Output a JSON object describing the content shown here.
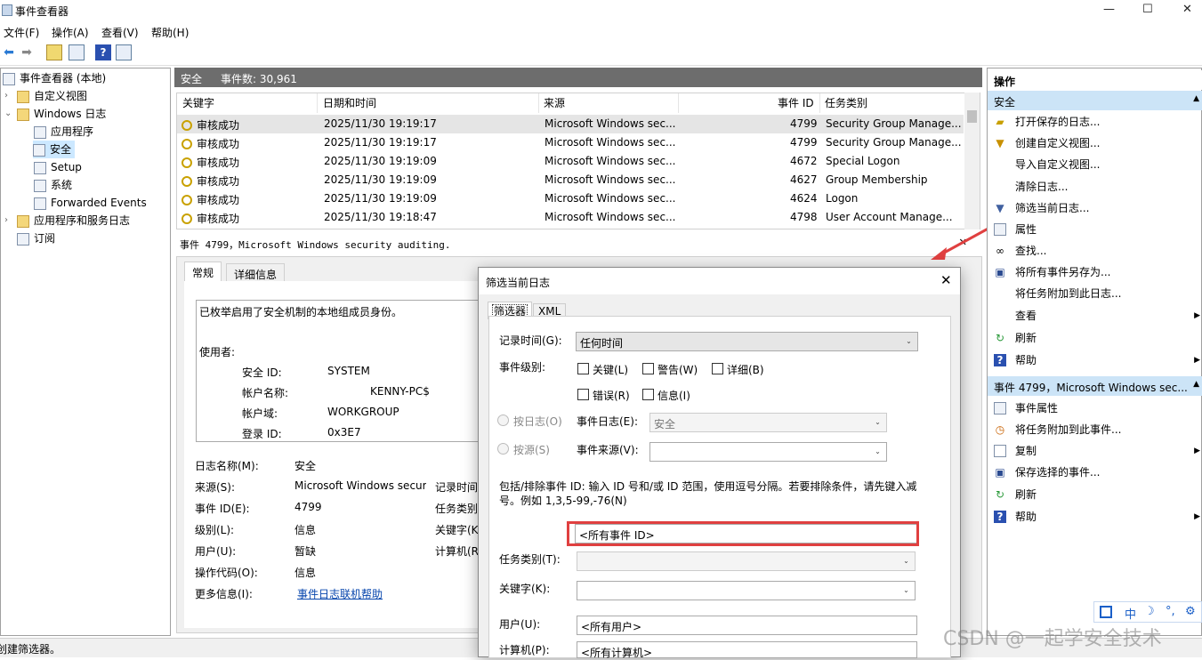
{
  "window": {
    "title": "事件查看器",
    "minimize": "—",
    "maximize": "☐",
    "close": "✕"
  },
  "menu": [
    "文件(F)",
    "操作(A)",
    "查看(V)",
    "帮助(H)"
  ],
  "tree": {
    "root": "事件查看器 (本地)",
    "custom_views": "自定义视图",
    "windows_logs": "Windows 日志",
    "app": "应用程序",
    "security": "安全",
    "setup": "Setup",
    "system": "系统",
    "forwarded": "Forwarded Events",
    "app_services": "应用程序和服务日志",
    "subscriptions": "订阅"
  },
  "center": {
    "log_name": "安全",
    "event_count": "事件数: 30,961"
  },
  "grid": {
    "columns": [
      "关键字",
      "日期和时间",
      "来源",
      "事件 ID",
      "任务类别"
    ],
    "rows": [
      [
        "审核成功",
        "2025/11/30 19:19:17",
        "Microsoft Windows sec...",
        "4799",
        "Security Group Manage..."
      ],
      [
        "审核成功",
        "2025/11/30 19:19:17",
        "Microsoft Windows sec...",
        "4799",
        "Security Group Manage..."
      ],
      [
        "审核成功",
        "2025/11/30 19:19:09",
        "Microsoft Windows sec...",
        "4672",
        "Special Logon"
      ],
      [
        "审核成功",
        "2025/11/30 19:19:09",
        "Microsoft Windows sec...",
        "4627",
        "Group Membership"
      ],
      [
        "审核成功",
        "2025/11/30 19:19:09",
        "Microsoft Windows sec...",
        "4624",
        "Logon"
      ],
      [
        "审核成功",
        "2025/11/30 19:18:47",
        "Microsoft Windows sec...",
        "4798",
        "User Account Manage..."
      ]
    ]
  },
  "detail": {
    "header": "事件 4799，Microsoft Windows security auditing.",
    "tab_general": "常规",
    "tab_details": "详细信息",
    "description": "已枚举启用了安全机制的本地组成员身份。",
    "subject": "使用者:",
    "sid_label": "安全 ID:",
    "sid_value": "SYSTEM",
    "account_label": "帐户名称:",
    "account_value": "KENNY-PC$",
    "domain_label": "帐户域:",
    "domain_value": "WORKGROUP",
    "logon_label": "登录 ID:",
    "logon_value": "0x3E7",
    "f_logname": "日志名称(M):",
    "v_logname": "安全",
    "f_source": "来源(S):",
    "v_source": "Microsoft Windows secur",
    "f_logged": "记录时间",
    "f_eventid": "事件 ID(E):",
    "v_eventid": "4799",
    "f_task": "任务类别",
    "f_level": "级别(L):",
    "v_level": "信息",
    "f_keywords": "关键字(K",
    "f_user": "用户(U):",
    "v_user": "暂缺",
    "f_computer": "计算机(R",
    "f_opcode": "操作代码(O):",
    "v_opcode": "信息",
    "f_more": "更多信息(I):",
    "v_more": "事件日志联机帮助"
  },
  "actions": {
    "header": "操作",
    "section1": "安全",
    "items1": [
      "打开保存的日志...",
      "创建自定义视图...",
      "导入自定义视图...",
      "清除日志...",
      "筛选当前日志...",
      "属性",
      "查找...",
      "将所有事件另存为...",
      "将任务附加到此日志...",
      "查看",
      "刷新",
      "帮助"
    ],
    "section2": "事件 4799，Microsoft Windows sec...",
    "items2": [
      "事件属性",
      "将任务附加到此事件...",
      "复制",
      "保存选择的事件...",
      "刷新",
      "帮助"
    ]
  },
  "status": "创建筛选器。",
  "dialog": {
    "title": "筛选当前日志",
    "tab_filter": "筛选器",
    "tab_xml": "XML",
    "logged_label": "记录时间(G):",
    "logged_value": "任何时间",
    "level_label": "事件级别:",
    "lv_critical": "关键(L)",
    "lv_warning": "警告(W)",
    "lv_verbose": "详细(B)",
    "lv_error": "错误(R)",
    "lv_info": "信息(I)",
    "by_log": "按日志(O)",
    "by_source": "按源(S)",
    "event_logs_label": "事件日志(E):",
    "event_logs_value": "安全",
    "event_source_label": "事件来源(V):",
    "instruction": "包括/排除事件 ID: 输入 ID 号和/或 ID 范围，使用逗号分隔。若要排除条件，请先键入减号。例如 1,3,5-99,-76(N)",
    "event_id_value": "<所有事件 ID>",
    "task_label": "任务类别(T):",
    "keywords_label": "关键字(K):",
    "user_label": "用户(U):",
    "user_value": "<所有用户>",
    "computer_label": "计算机(P):",
    "computer_value": "<所有计算机>"
  },
  "watermark": "CSDN @一起学安全技术",
  "ime": [
    "中",
    "☽",
    "°,",
    "⚙"
  ]
}
